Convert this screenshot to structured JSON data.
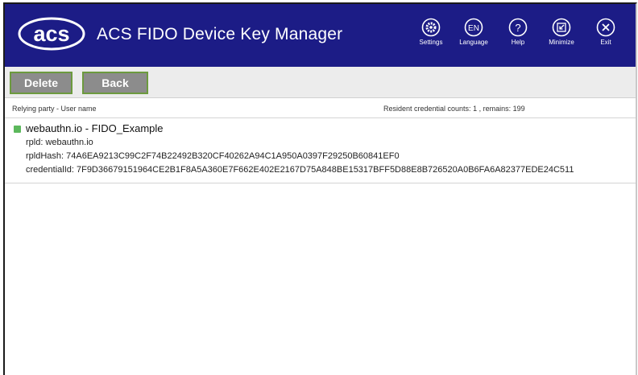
{
  "app": {
    "title": "ACS FIDO Device Key Manager",
    "logo_text": "acs"
  },
  "header_buttons": [
    {
      "label": "Settings",
      "icon": "gear-icon"
    },
    {
      "label": "Language",
      "icon": "EN"
    },
    {
      "label": "Help",
      "icon": "?"
    },
    {
      "label": "Minimize",
      "icon": "minimize-icon"
    },
    {
      "label": "Exit",
      "icon": "close-icon"
    }
  ],
  "toolbar": {
    "delete_label": "Delete",
    "back_label": "Back"
  },
  "columns": {
    "left": "Relying party - User name",
    "right": "Resident credential counts: 1 , remains: 199"
  },
  "entries": [
    {
      "title": "webauthn.io - FIDO_Example",
      "checked": true,
      "rpid": "rpld: webauthn.io",
      "rpid_hash": "rpldHash: 74A6EA9213C99C2F74B22492B320CF40262A94C1A950A0397F29250B60841EF0",
      "credential_id": "credentialId: 7F9D36679151964CE2B1F8A5A360E7F662E402E2167D75A848BE15317BFF5D88E8B726520A0B6FA6A82377EDE24C511"
    }
  ],
  "colors": {
    "header_bg": "#1c1c86",
    "button_bg": "#8c8c8c",
    "button_border": "#6c9a3e",
    "check": "#5cb85c"
  }
}
